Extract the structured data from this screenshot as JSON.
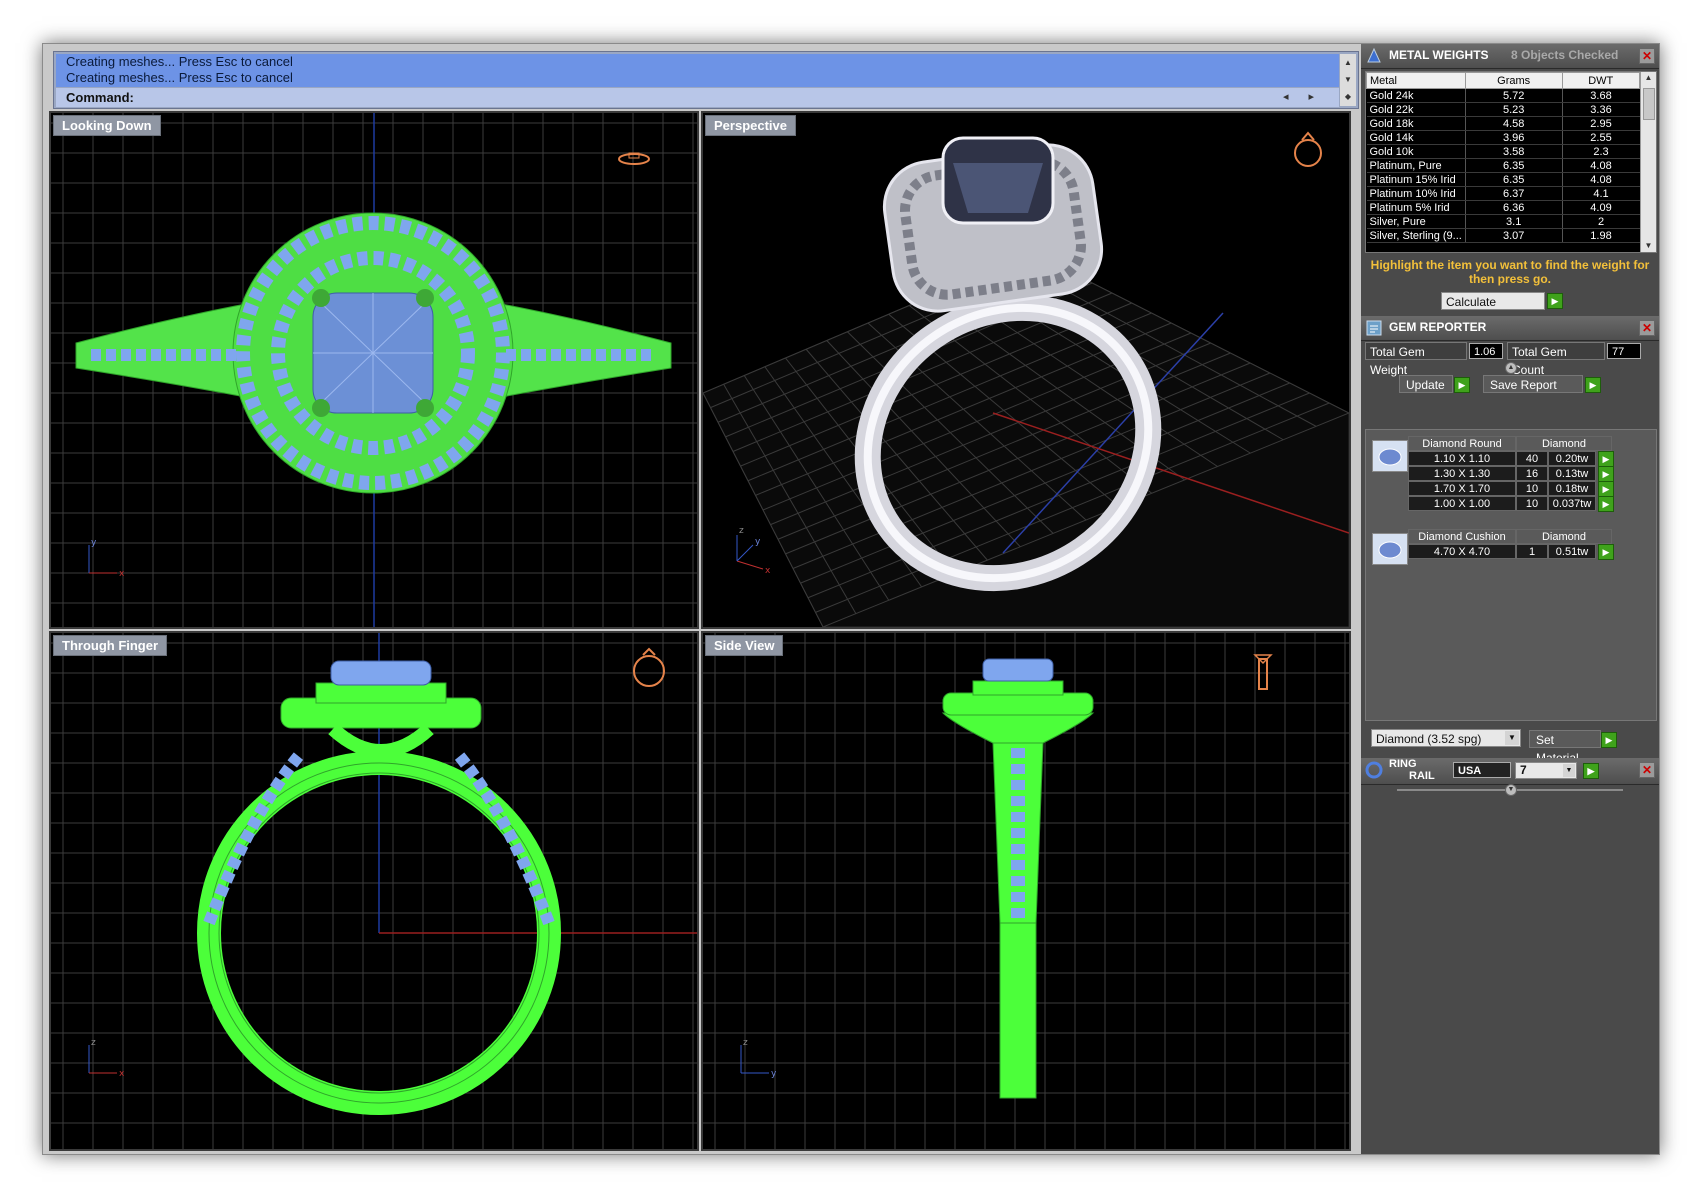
{
  "command": {
    "history": [
      "Creating meshes... Press Esc to cancel",
      "Creating meshes... Press Esc to cancel"
    ],
    "prompt": "Command:"
  },
  "viewports": [
    {
      "label": "Looking Down"
    },
    {
      "label": "Perspective"
    },
    {
      "label": "Through Finger"
    },
    {
      "label": "Side View"
    }
  ],
  "metal_weights": {
    "title": "METAL WEIGHTS",
    "status": "8 Objects Checked",
    "columns": [
      "Metal",
      "Grams",
      "DWT"
    ],
    "rows": [
      [
        "Gold 24k",
        "5.72",
        "3.68"
      ],
      [
        "Gold 22k",
        "5.23",
        "3.36"
      ],
      [
        "Gold 18k",
        "4.58",
        "2.95"
      ],
      [
        "Gold 14k",
        "3.96",
        "2.55"
      ],
      [
        "Gold 10k",
        "3.58",
        "2.3"
      ],
      [
        "Platinum, Pure",
        "6.35",
        "4.08"
      ],
      [
        "Platinum 15% Irid",
        "6.35",
        "4.08"
      ],
      [
        "Platinum 10% Irid",
        "6.37",
        "4.1"
      ],
      [
        "Platinum 5% Irid",
        "6.36",
        "4.09"
      ],
      [
        "Silver, Pure",
        "3.1",
        "2"
      ],
      [
        "Silver, Sterling (9...",
        "3.07",
        "1.98"
      ]
    ],
    "hint": "Highlight the item you want to find the weight for then press go.",
    "calculate_label": "Calculate"
  },
  "gem_reporter": {
    "title": "GEM REPORTER",
    "total_weight_label": "Total Gem Weight",
    "total_weight_value": "1.06",
    "total_count_label": "Total Gem Count",
    "total_count_value": "77",
    "update_label": "Update",
    "save_label": "Save Report",
    "groups": [
      {
        "shape": "Diamond Round",
        "material": "Diamond",
        "rows": [
          {
            "size": "1.10 X 1.10",
            "count": "40",
            "weight": "0.20tw"
          },
          {
            "size": "1.30 X 1.30",
            "count": "16",
            "weight": "0.13tw"
          },
          {
            "size": "1.70 X 1.70",
            "count": "10",
            "weight": "0.18tw"
          },
          {
            "size": "1.00 X 1.00",
            "count": "10",
            "weight": "0.037tw"
          }
        ]
      },
      {
        "shape": "Diamond Cushion",
        "material": "Diamond",
        "rows": [
          {
            "size": "4.70 X 4.70",
            "count": "1",
            "weight": "0.51tw"
          }
        ]
      }
    ],
    "material_select": "Diamond    (3.52 spg)",
    "set_material_label": "Set Material"
  },
  "ring_rail": {
    "title_line1": "RING",
    "title_line2": "RAIL",
    "standard": "USA",
    "size": "7"
  },
  "colors": {
    "wireframe": "#4cff3a",
    "gems": "#7fa6ee",
    "command_bg": "#6d93e6",
    "hint": "#f3c03a",
    "go_button": "#3fa21b"
  }
}
